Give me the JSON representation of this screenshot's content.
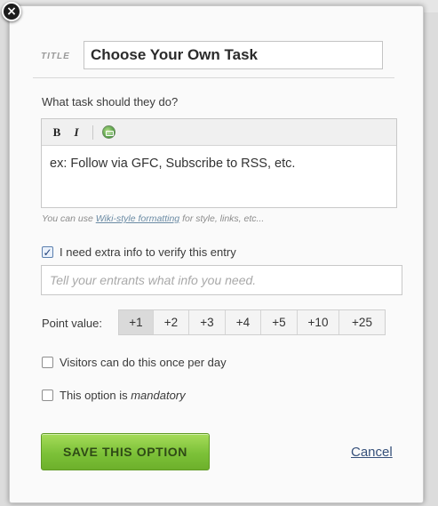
{
  "close_icon": "×",
  "title_field": {
    "label": "TITLE",
    "value": "Choose Your Own Task"
  },
  "task_question": "What task should they do?",
  "editor": {
    "toolbar": {
      "bold_label": "B",
      "italic_label": "I",
      "image_icon": "insert-image-icon"
    },
    "content": "ex: Follow via GFC, Subscribe to RSS, etc."
  },
  "wiki_note": {
    "prefix": "You can use ",
    "link": "Wiki-style formatting",
    "suffix": " for style, links, etc..."
  },
  "extra_info": {
    "checked": true,
    "label": "I need extra info to verify this entry",
    "placeholder": "Tell your entrants what info you need."
  },
  "point_value": {
    "label": "Point value:",
    "options": [
      "+1",
      "+2",
      "+3",
      "+4",
      "+5",
      "+10",
      "+25"
    ],
    "selected": "+1"
  },
  "once_per_day": {
    "checked": false,
    "label": "Visitors can do this once per day"
  },
  "mandatory": {
    "checked": false,
    "label_prefix": "This option is ",
    "label_emphasis": "mandatory"
  },
  "save_button": "SAVE THIS OPTION",
  "cancel_link": "Cancel",
  "colors": {
    "save_green": "#7cc138",
    "link_blue": "#36507a",
    "selected_point_bg": "#dadada"
  }
}
